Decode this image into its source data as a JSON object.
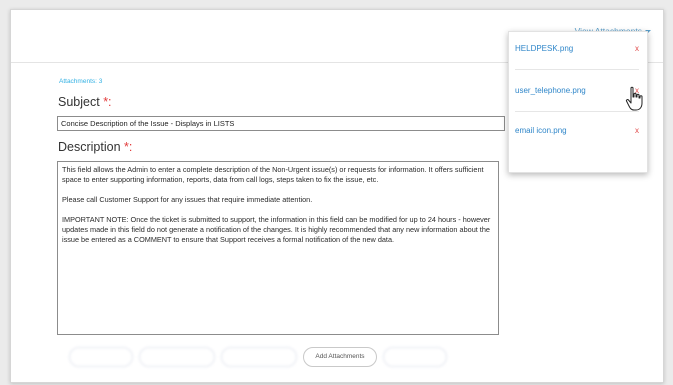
{
  "header": {
    "view_attachments_label": "View Attachments"
  },
  "attachments": {
    "count_label": "Attachments: 3",
    "items": [
      {
        "name": "HELDPESK.png",
        "delete": "x"
      },
      {
        "name": "user_telephone.png",
        "delete": "x"
      },
      {
        "name": "email icon.png",
        "delete": "x"
      }
    ]
  },
  "form": {
    "subject_label": "Subject",
    "subject_required": "*:",
    "subject_value": "Concise Description of the Issue - Displays in LISTS",
    "description_label": "Description",
    "description_required": "*:",
    "description_paragraphs": [
      "This field allows the Admin to enter a complete description of the Non-Urgent issue(s) or requests for information. It offers sufficient space to enter supporting information, reports, data from call logs, steps taken to fix the issue, etc.",
      "Please call Customer Support for any issues that require immediate attention.",
      "IMPORTANT NOTE: Once the ticket is submitted to support, the information in this field can be modified for up to 24 hours - however updates made in this field do not generate a notification of the changes. It is highly recommended that any new information about the issue be entered as a COMMENT to ensure that Support receives a formal notification of the new data."
    ]
  },
  "actions": {
    "add_attachments_label": "Add Attachments"
  },
  "colors": {
    "link": "#2f86c9",
    "required": "#e23b3b",
    "delete": "#e04a4a",
    "count": "#33b1e3"
  },
  "icons": {
    "cursor": "hand-pointer-icon",
    "dropdown": "caret-down-icon"
  }
}
